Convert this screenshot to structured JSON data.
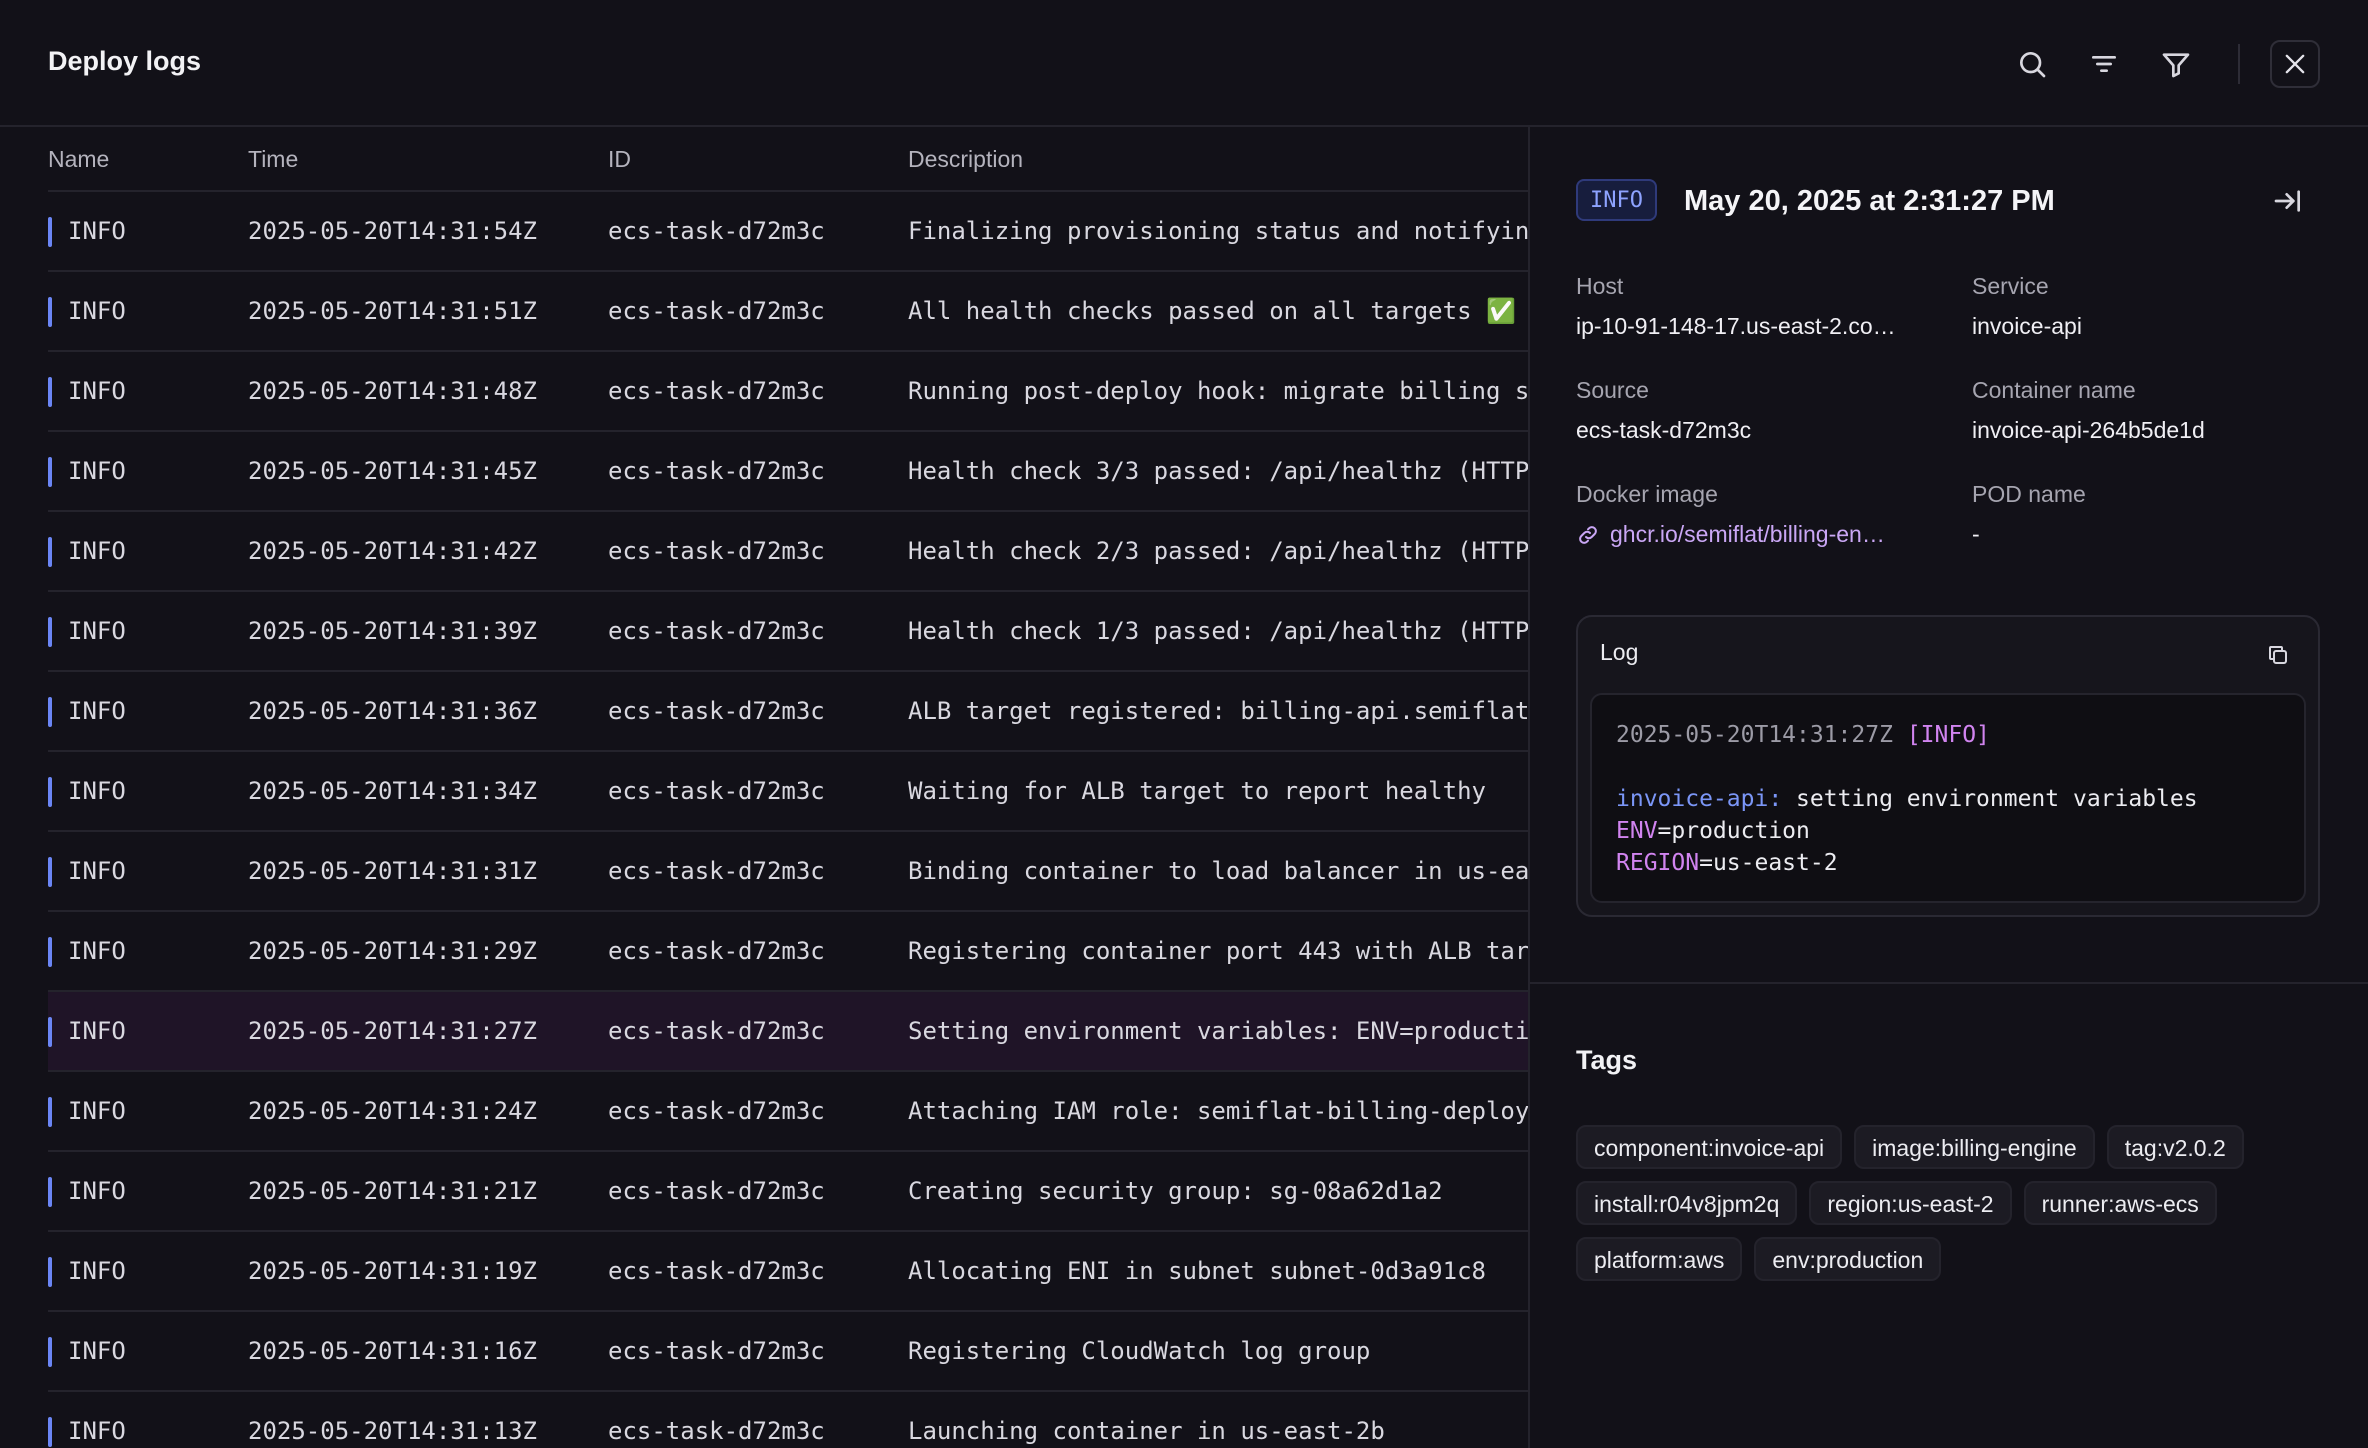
{
  "header": {
    "title": "Deploy logs",
    "icons": [
      "search-icon",
      "sort-lines-icon",
      "filter-icon",
      "close-icon"
    ]
  },
  "table": {
    "columns": {
      "name": "Name",
      "time": "Time",
      "id": "ID",
      "description": "Description"
    },
    "rows": [
      {
        "name": "INFO",
        "time": "2025-05-20T14:31:54Z",
        "id": "ecs-task-d72m3c",
        "description": "Finalizing provisioning status and notifyin"
      },
      {
        "name": "INFO",
        "time": "2025-05-20T14:31:51Z",
        "id": "ecs-task-d72m3c",
        "description": "All health checks passed on all targets ✅"
      },
      {
        "name": "INFO",
        "time": "2025-05-20T14:31:48Z",
        "id": "ecs-task-d72m3c",
        "description": "Running post-deploy hook: migrate billing s"
      },
      {
        "name": "INFO",
        "time": "2025-05-20T14:31:45Z",
        "id": "ecs-task-d72m3c",
        "description": "Health check 3/3 passed: /api/healthz (HTTP"
      },
      {
        "name": "INFO",
        "time": "2025-05-20T14:31:42Z",
        "id": "ecs-task-d72m3c",
        "description": "Health check 2/3 passed: /api/healthz (HTTP"
      },
      {
        "name": "INFO",
        "time": "2025-05-20T14:31:39Z",
        "id": "ecs-task-d72m3c",
        "description": "Health check 1/3 passed: /api/healthz (HTTP"
      },
      {
        "name": "INFO",
        "time": "2025-05-20T14:31:36Z",
        "id": "ecs-task-d72m3c",
        "description": "ALB target registered: billing-api.semiflat"
      },
      {
        "name": "INFO",
        "time": "2025-05-20T14:31:34Z",
        "id": "ecs-task-d72m3c",
        "description": "Waiting for ALB target to report healthy"
      },
      {
        "name": "INFO",
        "time": "2025-05-20T14:31:31Z",
        "id": "ecs-task-d72m3c",
        "description": "Binding container to load balancer in us-ea"
      },
      {
        "name": "INFO",
        "time": "2025-05-20T14:31:29Z",
        "id": "ecs-task-d72m3c",
        "description": "Registering container port 443 with ALB tar"
      },
      {
        "name": "INFO",
        "time": "2025-05-20T14:31:27Z",
        "id": "ecs-task-d72m3c",
        "description": "Setting environment variables: ENV=producti"
      },
      {
        "name": "INFO",
        "time": "2025-05-20T14:31:24Z",
        "id": "ecs-task-d72m3c",
        "description": "Attaching IAM role: semiflat-billing-deploy"
      },
      {
        "name": "INFO",
        "time": "2025-05-20T14:31:21Z",
        "id": "ecs-task-d72m3c",
        "description": "Creating security group: sg-08a62d1a2"
      },
      {
        "name": "INFO",
        "time": "2025-05-20T14:31:19Z",
        "id": "ecs-task-d72m3c",
        "description": "Allocating ENI in subnet subnet-0d3a91c8"
      },
      {
        "name": "INFO",
        "time": "2025-05-20T14:31:16Z",
        "id": "ecs-task-d72m3c",
        "description": "Registering CloudWatch log group"
      },
      {
        "name": "INFO",
        "time": "2025-05-20T14:31:13Z",
        "id": "ecs-task-d72m3c",
        "description": "Launching container in us-east-2b"
      }
    ],
    "selected_row": 10
  },
  "detail": {
    "level": "INFO",
    "date": "May 20, 2025 at 2:31:27 PM",
    "fields": {
      "host_label": "Host",
      "host_value": "ip-10-91-148-17.us-east-2.co…",
      "service_label": "Service",
      "service_value": "invoice-api",
      "source_label": "Source",
      "source_value": "ecs-task-d72m3c",
      "container_label": "Container name",
      "container_value": "invoice-api-264b5de1d",
      "docker_label": "Docker image",
      "docker_value": "ghcr.io/semiflat/billing-en…",
      "pod_label": "POD name",
      "pod_value": "-"
    },
    "log": {
      "label": "Log",
      "timestamp": "2025-05-20T14:31:27Z",
      "level_tag": "[INFO]",
      "source": "invoice-api:",
      "message": "setting environment variables",
      "env_key": "ENV",
      "env_value": "=production",
      "region_key": "REGION",
      "region_value": "=us-east-2"
    },
    "tags_title": "Tags",
    "tags": [
      "component:invoice-api",
      "image:billing-engine",
      "tag:v2.0.2",
      "install:r04v8jpm2q",
      "region:us-east-2",
      "runner:aws-ecs",
      "platform:aws",
      "env:production"
    ]
  },
  "colors": {
    "background": "#121118",
    "row_accent": "#6b86f5",
    "selected_row": "#1f1427",
    "link": "#caa7f5",
    "badge_text": "#8ea3ff"
  }
}
